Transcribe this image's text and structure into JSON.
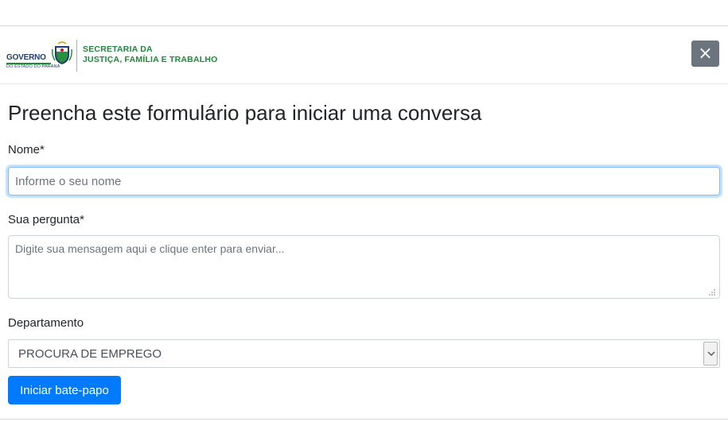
{
  "header": {
    "logo_governo": "GOVERNO",
    "logo_estado": "DO ESTADO DO PARANÁ",
    "secretaria_line1": "SECRETARIA DA",
    "secretaria_line2": "JUSTIÇA, FAMÍLIA E TRABALHO",
    "close_label": "×"
  },
  "form": {
    "title": "Preencha este formulário para iniciar uma conversa",
    "name_label": "Nome*",
    "name_placeholder": "Informe o seu nome",
    "name_value": "",
    "question_label": "Sua pergunta*",
    "question_placeholder": "Digite sua mensagem aqui e clique enter para enviar...",
    "question_value": "",
    "department_label": "Departamento",
    "department_selected": "PROCURA DE EMPREGO",
    "submit_label": "Iniciar bate-papo"
  },
  "colors": {
    "primary": "#007bff",
    "secondary": "#6c757d",
    "brand_green": "#1d8a3a",
    "brand_blue": "#1d3f73"
  },
  "icons": {
    "close": "close-icon",
    "select_arrow": "chevron-down-icon",
    "resize": "resize-handle-icon",
    "coat_of_arms": "coat-of-arms-icon"
  }
}
